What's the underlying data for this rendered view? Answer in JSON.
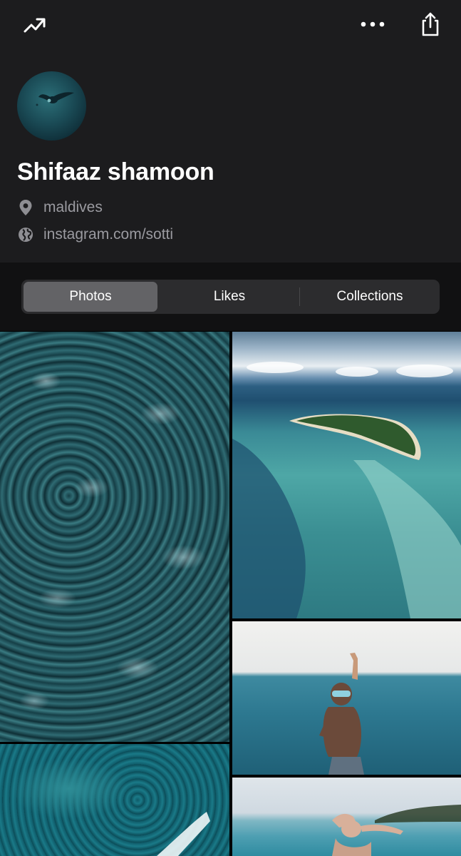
{
  "topbar": {
    "left_icon": "trending-up-icon",
    "right_icons": [
      "more-icon",
      "share-icon"
    ]
  },
  "profile": {
    "name": "Shifaaz shamoon",
    "location": "maldives",
    "website": "instagram.com/sotti",
    "location_icon": "location-pin-icon",
    "website_icon": "globe-icon"
  },
  "tabs": {
    "selected": "Photos",
    "items": [
      {
        "label": "Photos"
      },
      {
        "label": "Likes"
      },
      {
        "label": "Collections"
      }
    ]
  },
  "colors": {
    "header_bg": "#1c1c1e",
    "segment_bg": "#2c2c2e",
    "segment_selected": "#636366",
    "secondary_text": "#9a9aa0"
  },
  "photos": [
    {
      "subject": "ocean-waves"
    },
    {
      "subject": "aerial-atoll"
    },
    {
      "subject": "snorkeler-split-view"
    },
    {
      "subject": "reef-aerial-boat"
    },
    {
      "subject": "swimmer-at-surface"
    }
  ]
}
